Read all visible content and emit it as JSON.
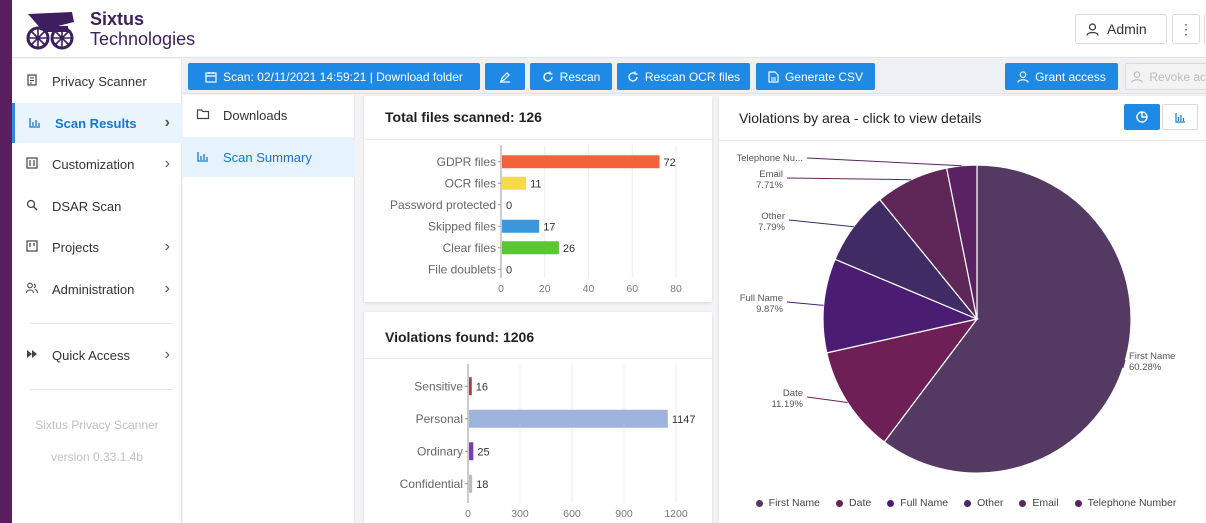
{
  "header": {
    "brand_line1": "Sixtus",
    "brand_line2": "Technologies",
    "admin_label": "Admin",
    "kebab": "⋮"
  },
  "sidebar": {
    "items": [
      {
        "label": "Privacy Scanner",
        "icon": "scanner-icon"
      },
      {
        "label": "Scan Results",
        "icon": "bar-chart-icon",
        "active": true
      },
      {
        "label": "Customization",
        "icon": "sliders-icon"
      },
      {
        "label": "DSAR Scan",
        "icon": "search-icon"
      },
      {
        "label": "Projects",
        "icon": "board-icon"
      },
      {
        "label": "Administration",
        "icon": "users-icon"
      },
      {
        "label": "Quick Access",
        "icon": "fast-forward-icon"
      }
    ],
    "footer_name": "Sixtus Privacy Scanner",
    "footer_version": "version 0.33.1.4b"
  },
  "toolbar": {
    "scan_label": "Scan: 02/11/2021 14:59:21 | Download folder",
    "rescan_label": "Rescan",
    "rescan_ocr_label": "Rescan OCR files",
    "csv_label": "Generate CSV",
    "grant_label": "Grant access",
    "revoke_label": "Revoke acce"
  },
  "folders": [
    {
      "label": "Downloads",
      "icon": "folder-icon"
    },
    {
      "label": "Scan Summary",
      "icon": "bar-chart-icon",
      "active": true
    }
  ],
  "cards": {
    "files_title": "Total files scanned:",
    "files_count": "126",
    "violations_title": "Violations found:",
    "violations_count": "1206",
    "pie_title": "Violations by area - click to view details"
  },
  "colors": {
    "accent": "#1e8ae6",
    "brand": "#5a1e5e"
  },
  "chart_data": [
    {
      "type": "bar",
      "orientation": "horizontal",
      "categories": [
        "GDPR files",
        "OCR files",
        "Password protected",
        "Skipped files",
        "Clear files",
        "File doublets"
      ],
      "values": [
        72,
        11,
        0,
        17,
        26,
        0
      ],
      "colors": [
        "#f4623a",
        "#f7d94c",
        "#bbbbbb",
        "#3a97dc",
        "#5ac634",
        "#bbbbbb"
      ],
      "xticks": [
        0,
        20,
        40,
        60,
        80
      ],
      "xlim": [
        0,
        80
      ],
      "grid": true
    },
    {
      "type": "bar",
      "orientation": "horizontal",
      "categories": [
        "Sensitive",
        "Personal",
        "Ordinary",
        "Confidential"
      ],
      "values": [
        16,
        1147,
        25,
        18
      ],
      "colors": [
        "#c0343c",
        "#9fb4dc",
        "#7a3db3",
        "#bdbdbd"
      ],
      "xticks": [
        0,
        300,
        600,
        900,
        1200
      ],
      "xlim": [
        0,
        1200
      ],
      "grid": true
    },
    {
      "type": "pie",
      "slices": [
        {
          "name": "First Name",
          "label": "First Name",
          "value": 60.28,
          "display": "60.28%",
          "color": "#543962"
        },
        {
          "name": "Date",
          "label": "Date",
          "value": 11.19,
          "display": "11.19%",
          "color": "#6d1f56"
        },
        {
          "name": "Full Name",
          "label": "Full Name",
          "value": 9.87,
          "display": "9.87%",
          "color": "#4a1d72"
        },
        {
          "name": "Other",
          "label": "Other",
          "value": 7.79,
          "display": "7.79%",
          "color": "#412b64"
        },
        {
          "name": "Email",
          "label": "Email",
          "value": 7.71,
          "display": "7.71%",
          "color": "#5f2758"
        },
        {
          "name": "Telephone Number",
          "label": "Telephone Nu...",
          "value": 3.16,
          "display": "",
          "color": "#5a2262"
        }
      ],
      "legend_position": "bottom"
    }
  ]
}
